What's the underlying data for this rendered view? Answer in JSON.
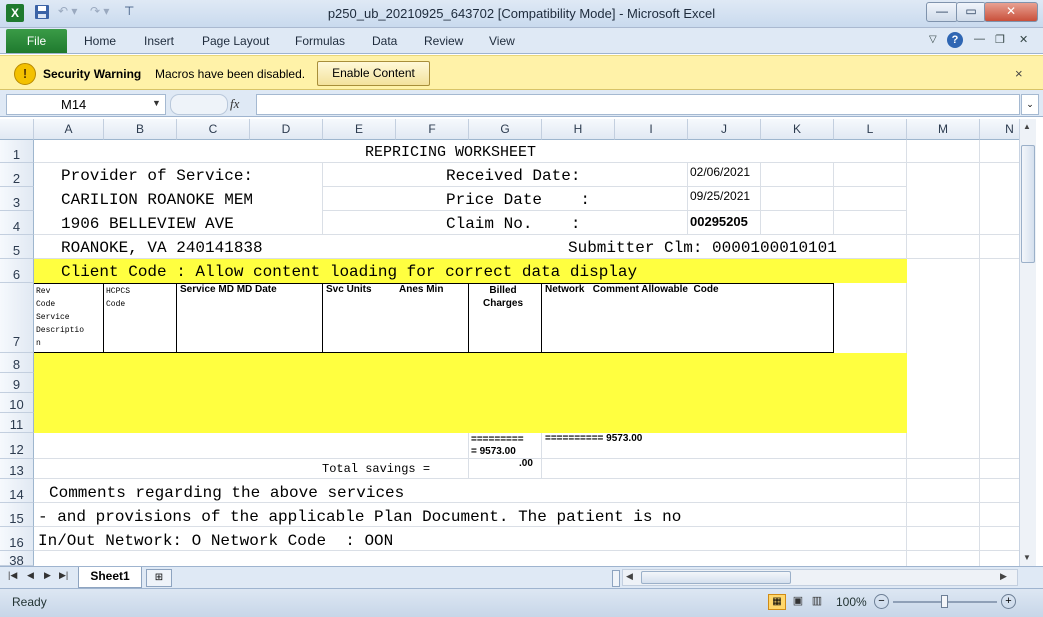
{
  "window": {
    "title": "p250_ub_20210925_643702  [Compatibility Mode]  -  Microsoft Excel",
    "minimize": "—",
    "restore": "▭",
    "close": "✕"
  },
  "ribbon": {
    "file_label": "File",
    "tabs": [
      "Home",
      "Insert",
      "Page Layout",
      "Formulas",
      "Data",
      "Review",
      "View"
    ]
  },
  "security": {
    "title": "Security Warning",
    "message": "Macros have been disabled.",
    "button": "Enable Content",
    "icon": "!",
    "close": "×"
  },
  "formula": {
    "name_box": "M14",
    "fx": "fx",
    "value": ""
  },
  "columns": [
    "A",
    "B",
    "C",
    "D",
    "E",
    "F",
    "G",
    "H",
    "I",
    "J",
    "K",
    "L",
    "M",
    "N"
  ],
  "rows": [
    "1",
    "2",
    "3",
    "4",
    "5",
    "6",
    "7",
    "8",
    "9",
    "10",
    "11",
    "12",
    "13",
    "14",
    "15",
    "16",
    "38"
  ],
  "sheet": {
    "title": "REPRICING WORKSHEET",
    "provider_label": "Provider of Service:",
    "provider_name": "CARILION ROANOKE MEM",
    "address1": "1906 BELLEVIEW AVE",
    "address2": "ROANOKE, VA 240141838",
    "received_label": "Received Date:",
    "received_date": "02/06/2021",
    "price_label": "Price Date    :",
    "price_date": "09/25/2021",
    "claim_label": "Claim No.    :",
    "claim_no": "00295205",
    "submitter": "Submitter Clm: 0000100010101",
    "client_code": "Client Code : Allow content loading for correct data display",
    "headers": {
      "rev_code": "Rev\nCode\nService\nDescriptio\nn",
      "hcpcs": "HCPCS\nCode",
      "service_md": "Service MD  MD  Date",
      "svc_units": "Svc Units",
      "anes_min": "Anes Min",
      "billed": "Billed\nCharges",
      "network": "Network   Comment Allowable  Code"
    },
    "totals_billed": "=========\n= 9573.00",
    "totals_allowable": "========== 9573.00",
    "total_savings_label": "Total savings =",
    "total_savings_value": ".00",
    "comment1": "Comments regarding the above services",
    "comment2": "- and provisions of the applicable Plan Document. The patient is no",
    "network_line": "In/Out Network: O Network Code  : OON"
  },
  "tabs_bar": {
    "sheet_name": "Sheet1"
  },
  "status": {
    "ready": "Ready",
    "zoom": "100%"
  },
  "colors": {
    "highlight": "#ffff40",
    "file_tab": "#2a8a3a",
    "security_bar": "#fff2a8"
  }
}
